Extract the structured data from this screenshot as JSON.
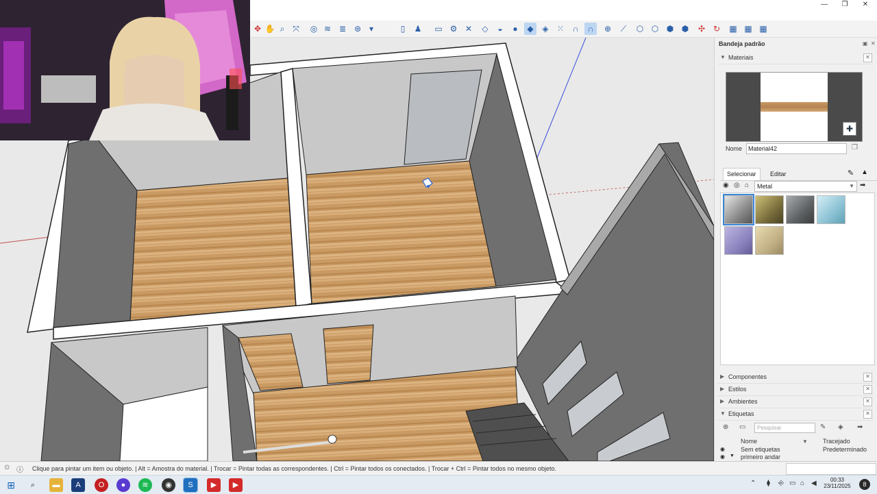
{
  "window": {
    "minimize_glyph": "—",
    "restore_glyph": "❐",
    "close_glyph": "✕"
  },
  "toolbar": {
    "tools": [
      "move-icon",
      "hand-icon",
      "zoom-icon",
      "zoom-extents-icon",
      "sections-icon",
      "styles-icon",
      "layers-icon",
      "camera-icon",
      "person-icon",
      "page-icon",
      "person-walk-icon",
      "box-icon",
      "gear-icon",
      "close-icon",
      "drop-icon",
      "drop-half-icon",
      "drop-full-icon",
      "paint-drop-icon",
      "eraser-icon",
      "grid-icon",
      "magnet-icon",
      "magnet-active-icon",
      "plus-circle-icon",
      "link-icon",
      "cube-icon",
      "cube-outline-icon",
      "cube-dark-icon",
      "cube-selected-icon",
      "axes-icon",
      "refresh-icon",
      "layers-a-icon",
      "layers-b-icon",
      "layers-c-icon"
    ]
  },
  "tray": {
    "title": "Bandeja padrão",
    "materials_section": "Materiais",
    "name_label": "Nome",
    "name_value": "Material42",
    "tab_select": "Selecionar",
    "tab_edit": "Editar",
    "library_value": "Metal",
    "swatches": [
      {
        "name": "swatch-metal-silver",
        "color": "#9a9a9a"
      },
      {
        "name": "swatch-metal-gold",
        "color": "#8d8248"
      },
      {
        "name": "swatch-metal-dark",
        "color": "#6b6e70"
      },
      {
        "name": "swatch-metal-blue",
        "color": "#8fc6d6"
      },
      {
        "name": "swatch-metal-purple",
        "color": "#8e86bf"
      },
      {
        "name": "swatch-metal-beige",
        "color": "#c5b58a"
      }
    ],
    "sections": [
      {
        "label": "Componentes",
        "expanded": false
      },
      {
        "label": "Estilos",
        "expanded": false
      },
      {
        "label": "Ambientes",
        "expanded": false
      },
      {
        "label": "Etiquetas",
        "expanded": true
      }
    ],
    "tags_search_placeholder": "Pesquisar",
    "tags_col_name": "Nome",
    "tags_col_dash": "Tracejado",
    "tags_rows": [
      {
        "name": "Sem etiquetas",
        "dash": "Predeterminado"
      },
      {
        "name": "primeiro andar",
        "dash": ""
      }
    ]
  },
  "status": {
    "text": "Clique para pintar um item ou objeto. | Alt = Amostra do material. | Trocar = Pintar todas as correspondentes. | Ctrl = Pintar todos os conectados. | Trocar + Ctrl = Pintar todos no mesmo objeto."
  },
  "taskbar": {
    "time": "00:33",
    "date": "23/11/2025"
  },
  "colors": {
    "wall": "#6f6f6f",
    "wall_light": "#a9a9a9",
    "wall_top": "#ffffff",
    "floor": "#c99a63",
    "viewport_bg": "#e9e9e9",
    "selection_blue": "#3b86d8"
  }
}
